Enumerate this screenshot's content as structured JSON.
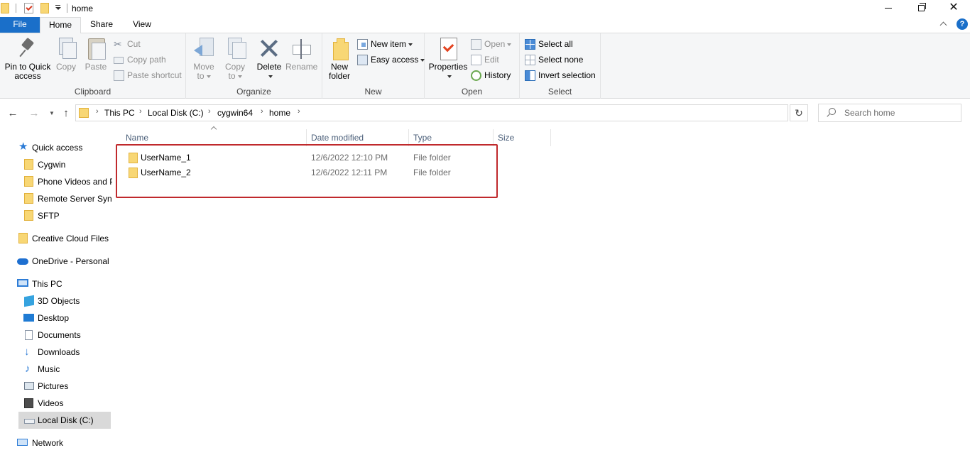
{
  "window": {
    "title": "home"
  },
  "ribbon_tabs": {
    "file": "File",
    "home": "Home",
    "share": "Share",
    "view": "View"
  },
  "help_label": "?",
  "clipboard": {
    "label": "Clipboard",
    "pin_line1": "Pin to Quick",
    "pin_line2": "access",
    "copy": "Copy",
    "paste": "Paste",
    "cut": "Cut",
    "copy_path": "Copy path",
    "paste_shortcut": "Paste shortcut"
  },
  "organize": {
    "label": "Organize",
    "move_line1": "Move",
    "move_line2": "to",
    "copy_line1": "Copy",
    "copy_line2": "to",
    "delete": "Delete",
    "rename": "Rename"
  },
  "new_group": {
    "label": "New",
    "new_folder_line1": "New",
    "new_folder_line2": "folder",
    "new_item": "New item",
    "easy_access": "Easy access"
  },
  "open_group": {
    "label": "Open",
    "properties": "Properties",
    "open": "Open",
    "edit": "Edit",
    "history": "History"
  },
  "select_group": {
    "label": "Select",
    "select_all": "Select all",
    "select_none": "Select none",
    "invert_selection": "Invert selection"
  },
  "address": {
    "crumbs": [
      "This PC",
      "Local Disk (C:)",
      "cygwin64",
      "home"
    ]
  },
  "search": {
    "placeholder": "Search home"
  },
  "nav_pane": {
    "quick_access": "Quick access",
    "quick_items": [
      "Cygwin",
      "Phone Videos and Photos",
      "Remote Server Sync",
      "SFTP"
    ],
    "creative_cloud": "Creative Cloud Files",
    "onedrive": "OneDrive - Personal",
    "this_pc": "This PC",
    "pc_items": [
      "3D Objects",
      "Desktop",
      "Documents",
      "Downloads",
      "Music",
      "Pictures",
      "Videos",
      "Local Disk (C:)"
    ],
    "network": "Network"
  },
  "columns": {
    "name": "Name",
    "date": "Date modified",
    "type": "Type",
    "size": "Size"
  },
  "files": [
    {
      "name": "UserName_1",
      "date": "12/6/2022 12:10 PM",
      "type": "File folder"
    },
    {
      "name": "UserName_2",
      "date": "12/6/2022 12:11 PM",
      "type": "File folder"
    }
  ],
  "colors": {
    "file_tab": "#1a6fc9",
    "folder": "#f8d775",
    "highlight_box": "#c0292c",
    "selected_nav": "#d9d9d9"
  }
}
